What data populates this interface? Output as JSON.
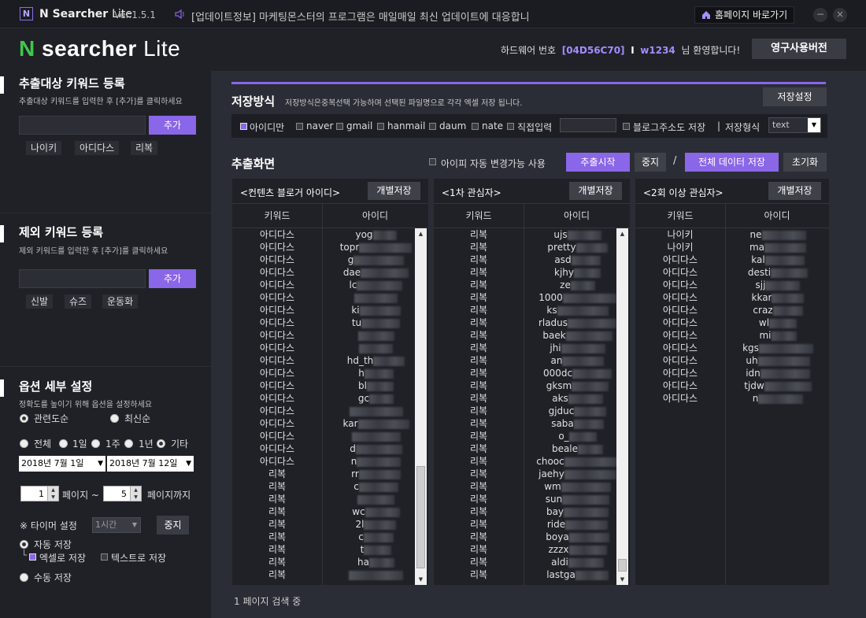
{
  "titlebar": {
    "logo_letter": "N",
    "app_name": "N Searcher",
    "app_suffix": "Lite",
    "version": "Ver.1.5.1",
    "notice": "[업데이트정보] 마케팅몬스터의 프로그램은 매일매일 최신 업데이트에 대응합니",
    "home_button": "홈페이지 바로가기",
    "minimize": "−",
    "close": "×"
  },
  "header": {
    "logo_n": "N",
    "logo_searcher": "searcher",
    "logo_lite": "Lite",
    "hw_label": "하드웨어 번호",
    "hw_code": "[04D56C70]",
    "separator": "I",
    "user": "w1234",
    "welcome": "님 환영합니다!",
    "perm_button": "영구사용버전"
  },
  "sidebar": {
    "extract": {
      "title": "추출대상 키워드 등록",
      "desc": "추출대상 키워드를 입력한 후 [추가]를 클릭하세요",
      "add_label": "추가",
      "tags": [
        "나이키",
        "아디다스",
        "리복"
      ]
    },
    "exclude": {
      "title": "제외 키워드 등록",
      "desc": "제외 키워드를 입력한 후 [추가]를 클릭하세요",
      "add_label": "추가",
      "tags": [
        "신발",
        "슈즈",
        "운동화"
      ]
    },
    "options": {
      "title": "옵션 세부 설정",
      "desc": "정확도를 높이기 위해 옵션을 설정하세요",
      "sort_relevance": "관련도순",
      "sort_latest": "최신순",
      "period": [
        "전체",
        "1일",
        "1주",
        "1년",
        "기타"
      ],
      "date_from": "2018년   7월   1일",
      "date_to": "2018년   7월  12일",
      "page_from": "1",
      "page_tilde": "페이지 ~",
      "page_to": "5",
      "page_until": "페이지까지",
      "timer_label": "※ 타이머 설정",
      "timer_value": "1시간",
      "timer_stop": "중지",
      "auto_save": "자동 저장",
      "excel_save": "엑셀로 저장",
      "text_save": "텍스트로 저장",
      "manual_save": "수동 저장",
      "excel_prefix": "└"
    }
  },
  "main": {
    "save_method": {
      "title": "저장방식",
      "desc": "저장방식은중복선택 가능하며 선택된 파일명으로 각각 엑셀 저장 됩니다.",
      "settings_button": "저장설정",
      "options": [
        "아이디만",
        "naver",
        "gmail",
        "hanmail",
        "daum",
        "nate",
        "직접입력"
      ],
      "blog_addr": "블로그주소도 저장",
      "divider": "|",
      "format_label": "저장형식",
      "format_value": "text"
    },
    "extract": {
      "title": "추출화면",
      "ip_change": "아이피 자동 변경가능 사용",
      "start_button": "추출시작",
      "stop_button": "중지",
      "slash": "/",
      "save_all_button": "전체 데이터 저장",
      "reset_button": "초기화"
    },
    "panels": [
      {
        "title": "<컨텐츠 블로거 아이디>",
        "save_button": "개별저장",
        "col_keyword": "키워드",
        "col_id": "아이디",
        "rows": [
          {
            "k": "아디다스",
            "id": "yog"
          },
          {
            "k": "아디다스",
            "id": "topr"
          },
          {
            "k": "아디다스",
            "id": "g"
          },
          {
            "k": "아디다스",
            "id": "dae"
          },
          {
            "k": "아디다스",
            "id": "lc"
          },
          {
            "k": "아디다스",
            "id": ""
          },
          {
            "k": "아디다스",
            "id": "ki"
          },
          {
            "k": "아디다스",
            "id": "tu"
          },
          {
            "k": "아디다스",
            "id": ""
          },
          {
            "k": "아디다스",
            "id": ""
          },
          {
            "k": "아디다스",
            "id": "hd_th"
          },
          {
            "k": "아디다스",
            "id": "h"
          },
          {
            "k": "아디다스",
            "id": "bl"
          },
          {
            "k": "아디다스",
            "id": "gc"
          },
          {
            "k": "아디다스",
            "id": ""
          },
          {
            "k": "아디다스",
            "id": "kar"
          },
          {
            "k": "아디다스",
            "id": ""
          },
          {
            "k": "아디다스",
            "id": "d"
          },
          {
            "k": "아디다스",
            "id": "n"
          },
          {
            "k": "리복",
            "id": "rr"
          },
          {
            "k": "리복",
            "id": "c"
          },
          {
            "k": "리복",
            "id": ""
          },
          {
            "k": "리복",
            "id": "wc"
          },
          {
            "k": "리복",
            "id": "2l"
          },
          {
            "k": "리복",
            "id": "c"
          },
          {
            "k": "리복",
            "id": "t"
          },
          {
            "k": "리복",
            "id": "ha"
          },
          {
            "k": "리복",
            "id": ""
          }
        ]
      },
      {
        "title": "<1차 관심자>",
        "save_button": "개별저장",
        "col_keyword": "키워드",
        "col_id": "아이디",
        "rows": [
          {
            "k": "리복",
            "id": "ujs"
          },
          {
            "k": "리복",
            "id": "pretty"
          },
          {
            "k": "리복",
            "id": "asd"
          },
          {
            "k": "리복",
            "id": "kjhy"
          },
          {
            "k": "리복",
            "id": "ze"
          },
          {
            "k": "리복",
            "id": "1000"
          },
          {
            "k": "리복",
            "id": "ks"
          },
          {
            "k": "리복",
            "id": "rladus"
          },
          {
            "k": "리복",
            "id": "baek"
          },
          {
            "k": "리복",
            "id": "jhi"
          },
          {
            "k": "리복",
            "id": "an"
          },
          {
            "k": "리복",
            "id": "000dc"
          },
          {
            "k": "리복",
            "id": "gksm"
          },
          {
            "k": "리복",
            "id": "aks"
          },
          {
            "k": "리복",
            "id": "gjduc"
          },
          {
            "k": "리복",
            "id": "saba"
          },
          {
            "k": "리복",
            "id": "o_"
          },
          {
            "k": "리복",
            "id": "beale"
          },
          {
            "k": "리복",
            "id": "chooc"
          },
          {
            "k": "리복",
            "id": "jaehy"
          },
          {
            "k": "리복",
            "id": "wm"
          },
          {
            "k": "리복",
            "id": "sun"
          },
          {
            "k": "리복",
            "id": "bay"
          },
          {
            "k": "리복",
            "id": "ride"
          },
          {
            "k": "리복",
            "id": "boya"
          },
          {
            "k": "리복",
            "id": "zzzx"
          },
          {
            "k": "리복",
            "id": "aldi"
          },
          {
            "k": "리복",
            "id": "lastga"
          }
        ]
      },
      {
        "title": "<2회 이상 관심자>",
        "save_button": "개별저장",
        "col_keyword": "키워드",
        "col_id": "아이디",
        "rows": [
          {
            "k": "나이키",
            "id": "ne"
          },
          {
            "k": "나이키",
            "id": "ma"
          },
          {
            "k": "아디다스",
            "id": "kal"
          },
          {
            "k": "아디다스",
            "id": "desti"
          },
          {
            "k": "아디다스",
            "id": "sjj"
          },
          {
            "k": "아디다스",
            "id": "kkar"
          },
          {
            "k": "아디다스",
            "id": "craz"
          },
          {
            "k": "아디다스",
            "id": "wl"
          },
          {
            "k": "아디다스",
            "id": "mi"
          },
          {
            "k": "아디다스",
            "id": "kgs"
          },
          {
            "k": "아디다스",
            "id": "uh"
          },
          {
            "k": "아디다스",
            "id": "idn"
          },
          {
            "k": "아디다스",
            "id": "tjdw"
          },
          {
            "k": "아디다스",
            "id": "n"
          }
        ]
      }
    ],
    "status": "1 페이지 검색 중"
  },
  "colors": {
    "accent": "#8a66e8",
    "brand_green": "#3fc84a",
    "highlight": "#a58cff",
    "background": "#1f2127",
    "panel": "#2a2d35"
  }
}
